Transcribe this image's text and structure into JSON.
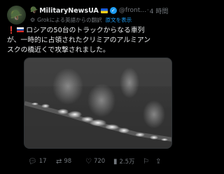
{
  "tweet": {
    "avatar_icon": "soldier-avatar",
    "name_emoji": "🪖",
    "display_name": "MilitaryNewsUA",
    "handle": "@front...",
    "separator": "·",
    "time": "4 時間",
    "translation_label": "Grokによる英語からの翻訳",
    "show_original": "原文を表示",
    "text_lines": [
      "ロシアの50台のトラックからなる車列",
      "が、一時的に占領されたクリミアのアルミアン",
      "スクの橋近くで攻撃されました。"
    ],
    "alert_icon": "❗",
    "media_description_icon": "thermal-video"
  },
  "actions": {
    "replies": "17",
    "retweets": "98",
    "likes": "720",
    "views": "2.5万"
  },
  "colors": {
    "accent": "#1d9bf0",
    "background": "#000000",
    "muted": "#71767b"
  }
}
